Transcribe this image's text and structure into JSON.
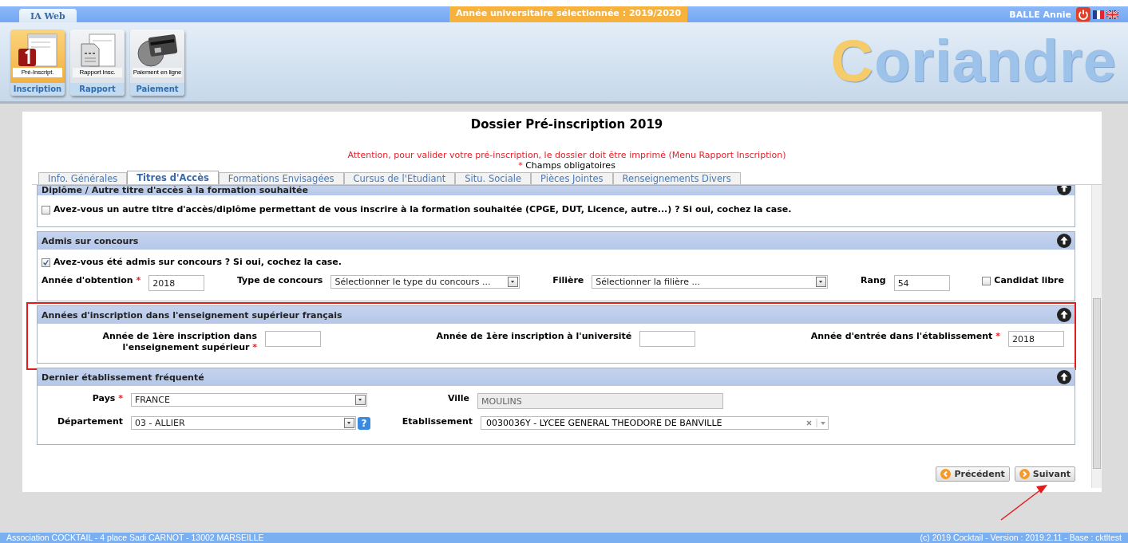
{
  "top_bar": {
    "app_tab": "IA Web",
    "academic_year": "Année universitaire sélectionnée : 2019/2020",
    "user": "BALLE Annie"
  },
  "toolbar": [
    {
      "caption": "Pré-Inscript.",
      "label": "Inscription",
      "kind": "form",
      "selected": true
    },
    {
      "caption": "Rapport Insc.",
      "label": "Rapport",
      "kind": "report",
      "selected": false
    },
    {
      "caption": "Paiement en ligne",
      "label": "Paiement",
      "kind": "card",
      "selected": false
    }
  ],
  "logo": "Coriandre",
  "page": {
    "title": "Dossier Pré-inscription 2019",
    "warning": "Attention, pour valider votre pré-inscription, le dossier doit être imprimé (Menu Rapport Inscription)",
    "required_mark": "*",
    "required_note": "Champs obligatoires"
  },
  "tabs": [
    {
      "label": "Info. Générales",
      "selected": false
    },
    {
      "label": "Titres d'Accès",
      "selected": true
    },
    {
      "label": "Formations Envisagées",
      "selected": false
    },
    {
      "label": "Cursus de l'Etudiant",
      "selected": false
    },
    {
      "label": "Situ. Sociale",
      "selected": false
    },
    {
      "label": "Pièces Jointes",
      "selected": false
    },
    {
      "label": "Renseignements Divers",
      "selected": false
    }
  ],
  "sections": [
    {
      "title": "Diplôme / Autre titre d'accès à la formation souhaitée",
      "kind": "spread",
      "highlighted": false,
      "rows": [
        [
          {
            "kind": "checkbox",
            "label": "Avez-vous un autre titre d'accès/diplôme permettant de vous inscrire à la formation souhaitée (CPGE, DUT, Licence, autre...) ? Si oui, cochez la case.",
            "checked": false
          }
        ]
      ]
    },
    {
      "title": "Admis sur concours",
      "kind": "spread",
      "highlighted": false,
      "rows": [
        [
          {
            "kind": "checkbox",
            "label": "Avez-vous été admis sur concours ? Si oui, cochez la case.",
            "checked": true
          }
        ],
        [
          {
            "kind": "text",
            "label": "Année d'obtention",
            "mark": "*",
            "value": "2018"
          },
          {
            "kind": "select",
            "label": "Type de concours",
            "value": "Sélectionner le type du concours ..."
          },
          {
            "kind": "select",
            "label": "Filière",
            "value": "Sélectionner la filière ..."
          },
          {
            "kind": "text",
            "label": "Rang",
            "value": "54"
          },
          {
            "kind": "checkbox",
            "label": "Candidat libre",
            "checked": false
          }
        ]
      ]
    },
    {
      "title": "Années d'inscription dans l'enseignement supérieur français",
      "kind": "spread",
      "highlighted": true,
      "rows": [
        [
          {
            "kind": "text",
            "label": "Année de 1ère inscription dans l'enseignement supérieur",
            "mark": "*"
          },
          {
            "kind": "text",
            "label": "Année de 1ère inscription à l'université"
          },
          {
            "kind": "text",
            "label": "Année d'entrée dans l'établissement",
            "mark": "*",
            "value": "2018"
          }
        ]
      ]
    },
    {
      "title": "Dernier établissement fréquenté",
      "kind": "grid",
      "highlighted": false,
      "rows": [
        [
          {
            "kind": "select",
            "label": "Pays",
            "mark": "*",
            "value": "FRANCE"
          },
          {
            "kind": "text",
            "label": "Ville",
            "value": "MOULINS",
            "disabled": true
          }
        ],
        [
          {
            "kind": "select",
            "label": "Département",
            "value": "03 - ALLIER",
            "help": "?"
          },
          {
            "kind": "combo",
            "label": "Etablissement",
            "value": "0030036Y - LYCEE GENERAL THEODORE DE BANVILLE"
          }
        ]
      ]
    }
  ],
  "buttons": [
    {
      "label": "Précédent",
      "kind": "previous"
    },
    {
      "label": "Suivant",
      "kind": "next"
    }
  ],
  "footer": {
    "address": "Association COCKTAIL - 4 place Sadi CARNOT - 13002 MARSEILLE",
    "version": "(c) 2019 Cocktail - Version : 2019.2.11 - Base : cktltest"
  }
}
